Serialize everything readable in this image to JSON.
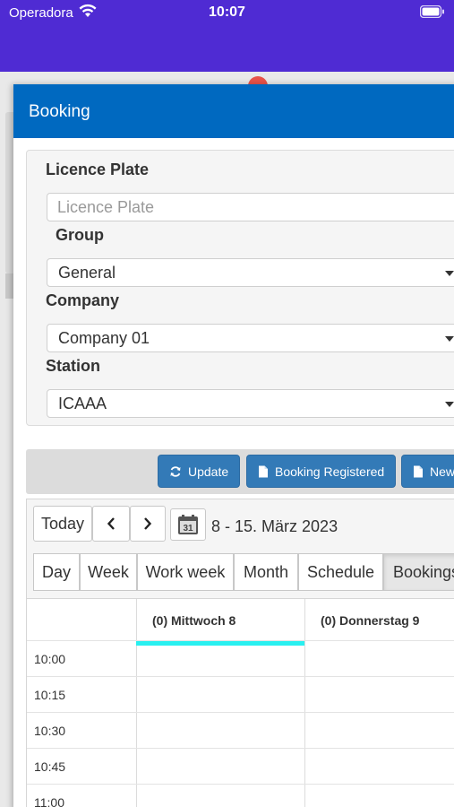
{
  "status_bar": {
    "carrier": "Operadora",
    "time": "10:07"
  },
  "modal": {
    "title": "Booking"
  },
  "form": {
    "licence_label": "Licence Plate",
    "licence_placeholder": "Licence Plate",
    "group_label": "Group",
    "group_value": "General",
    "company_label": "Company",
    "company_value": "Company 01",
    "station_label": "Station",
    "station_value": "ICAAA"
  },
  "toolbar": {
    "update": "Update",
    "booking_registered": "Booking Registered",
    "new": "New"
  },
  "scheduler": {
    "today": "Today",
    "date_range": "8 - 15. März 2023",
    "calendar_day": "31",
    "views": [
      "Day",
      "Week",
      "Work week",
      "Month",
      "Schedule",
      "Bookings"
    ],
    "columns": [
      "(0) Mittwoch 8",
      "(0) Donnerstag 9"
    ],
    "times": [
      "10:00",
      "10:15",
      "10:30",
      "10:45",
      "11:00"
    ]
  },
  "colors": {
    "status_bar": "#4f2bd3",
    "header": "#0069c0",
    "button": "#337ab7",
    "today_marker": "#29f0f0"
  }
}
